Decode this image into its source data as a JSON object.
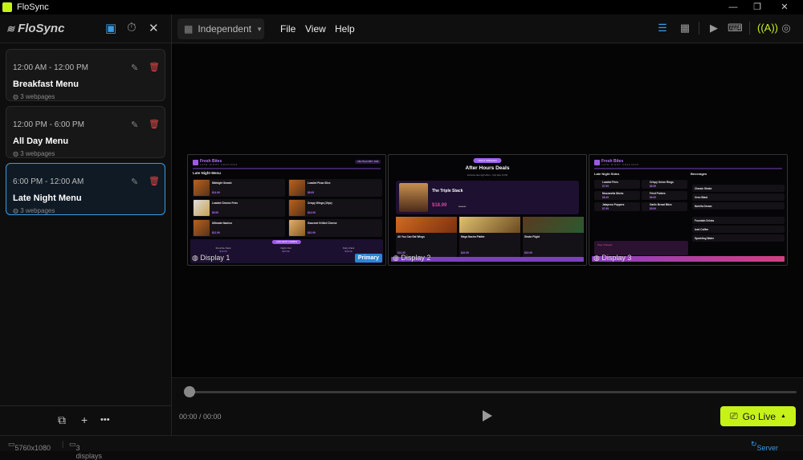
{
  "app": {
    "title": "FloSync",
    "brand": "FloSync"
  },
  "header": {
    "mode": "Independent",
    "menus": [
      "File",
      "View",
      "Help"
    ]
  },
  "schedules": [
    {
      "time": "12:00 AM - 12:00 PM",
      "name": "Breakfast Menu",
      "pages": "3 webpages"
    },
    {
      "time": "12:00 PM - 6:00 PM",
      "name": "All Day Menu",
      "pages": "3 webpages"
    },
    {
      "time": "6:00 PM - 12:00 AM",
      "name": "Late Night Menu",
      "pages": "3 webpages",
      "selected": true
    }
  ],
  "displays": [
    {
      "label": "Display 1",
      "badge": "Primary",
      "brand": "Fresh Bites",
      "tagline": "LATE NIGHT CRAVINGS",
      "section": "Late Night Menu",
      "hours": "After Hours 9PM - 3AM",
      "items": [
        {
          "name": "Midnight Smash",
          "price": "$14.99"
        },
        {
          "name": "Loaded Pizza Slice",
          "price": "$8.99"
        },
        {
          "name": "Loaded Cheese Fries",
          "price": "$9.99"
        },
        {
          "name": "Crispy Wings (10pc)",
          "price": "$13.99"
        },
        {
          "name": "Ultimate Nachos",
          "price": "$12.99"
        },
        {
          "name": "Gourmet Grilled Cheese",
          "price": "$10.99"
        }
      ],
      "combos_title": "LATE NIGHT COMBOS",
      "combos": [
        {
          "name": "Munchie Pack",
          "price": "$19.99"
        },
        {
          "name": "Night Owl",
          "price": "$20.99"
        },
        {
          "name": "Party Pack",
          "price": "$39.99"
        }
      ]
    },
    {
      "label": "Display 2",
      "pill": "NIGHT SPECIALS",
      "title": "After Hours Deals",
      "subtitle": "Exclusive late-night offers – Only after 10 PM",
      "feature": "The Triple Stack",
      "feature_price": "$18.99",
      "feature_old": "$25.00",
      "items": [
        {
          "name": "All You Can Eat Wings",
          "price": "$21.99"
        },
        {
          "name": "Mega Nacho Platter",
          "price": "$22.99"
        },
        {
          "name": "Shake Flight",
          "price": "$15.99"
        }
      ]
    },
    {
      "label": "Display 3",
      "brand": "Fresh Bites",
      "tagline": "LATE NIGHT CRAVINGS",
      "sides_title": "Late Night Sides",
      "bev_title": "Beverages",
      "sides": [
        {
          "name": "Loaded Fries",
          "price": "$7.99"
        },
        {
          "name": "Crispy Onion Rings",
          "price": "$6.99"
        },
        {
          "name": "Mozzarella Sticks",
          "price": "$8.49"
        },
        {
          "name": "Fried Pickles",
          "price": "$6.99"
        },
        {
          "name": "Jalapeno Poppers",
          "price": "$7.99"
        },
        {
          "name": "Garlic Bread Bites",
          "price": "$5.99"
        }
      ],
      "bevs": [
        "Classic Shake",
        "Oreo Blast",
        "Nutella Dream",
        "Fountain Drinks",
        "Iced Coffee",
        "Sparkling Water"
      ],
      "energy": "Stay Charged"
    }
  ],
  "timeline": {
    "time": "00:00 / 00:00",
    "progress": 0,
    "go_live": "Go Live"
  },
  "status": {
    "resolution": "5760x1080",
    "displays": "3 displays",
    "server": "Server"
  },
  "colors": {
    "accent": "#c6f21a",
    "blue": "#3a9be0",
    "delete": "#e04848",
    "purple": "#b779ff"
  }
}
